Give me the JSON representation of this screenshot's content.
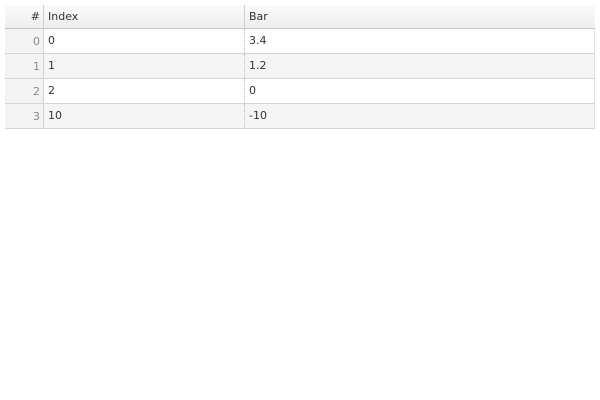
{
  "table": {
    "headers": {
      "num": "#",
      "index": "Index",
      "bar": "Bar"
    },
    "rows": [
      {
        "num": "0",
        "index": "0",
        "bar": "3.4"
      },
      {
        "num": "1",
        "index": "1",
        "bar": "1.2"
      },
      {
        "num": "2",
        "index": "2",
        "bar": "0"
      },
      {
        "num": "3",
        "index": "10",
        "bar": "-10"
      }
    ]
  }
}
